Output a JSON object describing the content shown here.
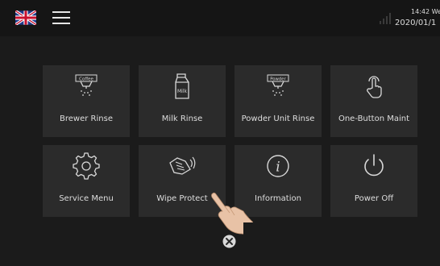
{
  "status_bar": {
    "time": "14:42 We",
    "date": "2020/01/1",
    "flag": "uk-flag-icon",
    "signal": "signal-strength-icon"
  },
  "menu": {
    "icon": "hamburger-menu-icon"
  },
  "tiles": [
    {
      "label": "Brewer Rinse",
      "icon": "coffee-rinse-icon",
      "icon_text": "Coffee"
    },
    {
      "label": "Milk Rinse",
      "icon": "milk-carton-icon",
      "icon_text": "Milk"
    },
    {
      "label": "Powder Unit Rinse",
      "icon": "powder-rinse-icon",
      "icon_text": "Powder"
    },
    {
      "label": "One-Button Maint",
      "icon": "touch-hand-icon"
    },
    {
      "label": "Service Menu",
      "icon": "gear-icon"
    },
    {
      "label": "Wipe Protect",
      "icon": "wipe-hand-icon"
    },
    {
      "label": "Information",
      "icon": "info-icon",
      "icon_text": "i"
    },
    {
      "label": "Power Off",
      "icon": "power-icon"
    }
  ],
  "overlay": {
    "close_icon": "close-icon",
    "pointer": "pointing-hand-icon"
  },
  "colors": {
    "background": "#1b1b1b",
    "topbar": "#151515",
    "tile": "#2b2b2b",
    "text": "#dedede"
  }
}
